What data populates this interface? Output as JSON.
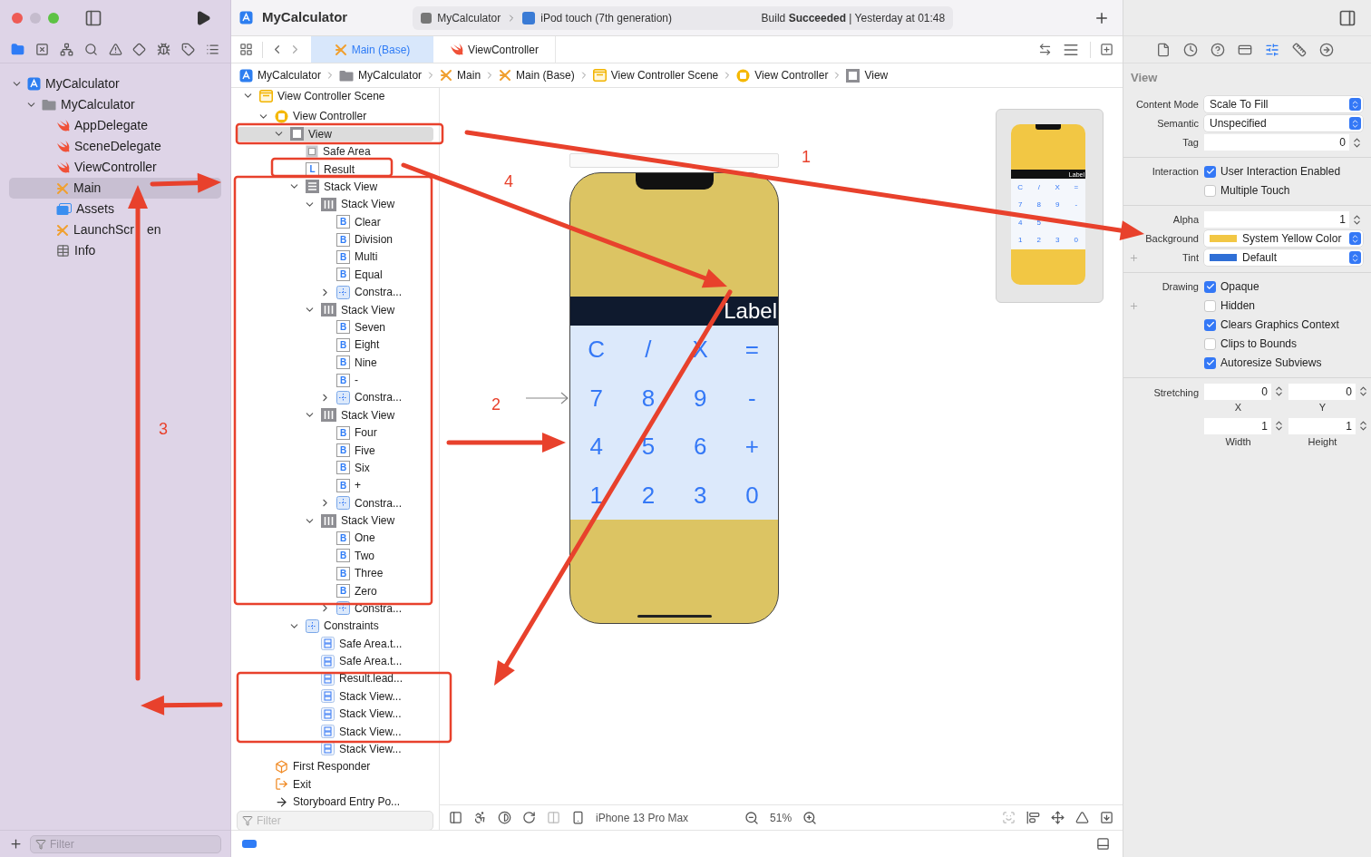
{
  "toolbar": {
    "project": "MyCalculator",
    "scheme": "MyCalculator",
    "device": "iPod touch (7th generation)",
    "status": "Build **Succeeded** | Yesterday at 01:48"
  },
  "navigator": {
    "tabs": [
      {
        "kind": "project-files",
        "selected": true
      },
      {
        "kind": "source-control",
        "selected": false
      },
      {
        "kind": "symbols",
        "selected": false
      },
      {
        "kind": "search",
        "selected": false
      },
      {
        "kind": "issues",
        "selected": false
      },
      {
        "kind": "tests",
        "selected": false
      },
      {
        "kind": "debug",
        "selected": false
      },
      {
        "kind": "breakpoints",
        "selected": false
      },
      {
        "kind": "reports",
        "selected": false
      }
    ],
    "tree": [
      {
        "label": "MyCalculator",
        "kind": "project",
        "expanded": true,
        "selected": false,
        "children": [
          {
            "label": "MyCalculator",
            "kind": "folder",
            "expanded": true,
            "selected": false,
            "children": [
              {
                "label": "AppDelegate",
                "kind": "swift",
                "selected": false
              },
              {
                "label": "SceneDelegate",
                "kind": "swift",
                "selected": false
              },
              {
                "label": "ViewController",
                "kind": "swift",
                "selected": false
              },
              {
                "label": "Main",
                "kind": "storyboard",
                "selected": true
              },
              {
                "label": "Assets",
                "kind": "assets",
                "selected": false
              },
              {
                "label": "LaunchScr",
                "label_tail": "en",
                "kind": "storyboard",
                "selected": false
              },
              {
                "label": "Info",
                "kind": "plist",
                "selected": false
              }
            ]
          }
        ]
      }
    ],
    "filter": {
      "placeholder": "Filter"
    }
  },
  "tabs": [
    {
      "label": "Main (Base)",
      "kind": "storyboard",
      "selected": true
    },
    {
      "label": "ViewController",
      "kind": "swift",
      "selected": false
    }
  ],
  "breadcrumb": [
    {
      "label": "MyCalculator",
      "kind": "project"
    },
    {
      "label": "MyCalculator",
      "kind": "folder"
    },
    {
      "label": "Main",
      "kind": "storyboard"
    },
    {
      "label": "Main (Base)",
      "kind": "storyboard"
    },
    {
      "label": "View Controller Scene",
      "kind": "scene"
    },
    {
      "label": "View Controller",
      "kind": "controller"
    },
    {
      "label": "View",
      "kind": "view"
    }
  ],
  "outline": {
    "tree": [
      {
        "label": "View Controller Scene",
        "kind": "scene",
        "expanded": true,
        "selected": false,
        "children": [
          {
            "label": "View Controller",
            "kind": "controller",
            "expanded": true,
            "selected": false,
            "children": [
              {
                "label": "View",
                "kind": "view",
                "expanded": true,
                "selected": true,
                "children": [
                  {
                    "label": "Safe Area",
                    "kind": "safe-area",
                    "selected": false
                  },
                  {
                    "label": "Result",
                    "kind": "badge",
                    "badge": "L",
                    "selected": false
                  },
                  {
                    "label": "Stack View",
                    "kind": "vstack",
                    "expanded": true,
                    "selected": false,
                    "children": [
                      {
                        "label": "Stack View",
                        "kind": "hstack",
                        "expanded": true,
                        "selected": false,
                        "children": [
                          {
                            "label": "Clear",
                            "kind": "badge",
                            "badge": "B",
                            "selected": false
                          },
                          {
                            "label": "Division",
                            "kind": "badge",
                            "badge": "B",
                            "selected": false
                          },
                          {
                            "label": "Multi",
                            "kind": "badge",
                            "badge": "B",
                            "selected": false
                          },
                          {
                            "label": "Equal",
                            "kind": "badge",
                            "badge": "B",
                            "selected": false
                          },
                          {
                            "label": "Constra...",
                            "kind": "constraints",
                            "expanded": false,
                            "selected": false
                          }
                        ]
                      },
                      {
                        "label": "Stack View",
                        "kind": "hstack",
                        "expanded": true,
                        "selected": false,
                        "children": [
                          {
                            "label": "Seven",
                            "kind": "badge",
                            "badge": "B",
                            "selected": false
                          },
                          {
                            "label": "Eight",
                            "kind": "badge",
                            "badge": "B",
                            "selected": false
                          },
                          {
                            "label": "Nine",
                            "kind": "badge",
                            "badge": "B",
                            "selected": false
                          },
                          {
                            "label": "-",
                            "kind": "badge",
                            "badge": "B",
                            "selected": false
                          },
                          {
                            "label": "Constra...",
                            "kind": "constraints",
                            "expanded": false,
                            "selected": false
                          }
                        ]
                      },
                      {
                        "label": "Stack View",
                        "kind": "hstack",
                        "expanded": true,
                        "selected": false,
                        "children": [
                          {
                            "label": "Four",
                            "kind": "badge",
                            "badge": "B",
                            "selected": false
                          },
                          {
                            "label": "Five",
                            "kind": "badge",
                            "badge": "B",
                            "selected": false
                          },
                          {
                            "label": "Six",
                            "kind": "badge",
                            "badge": "B",
                            "selected": false
                          },
                          {
                            "label": "+",
                            "kind": "badge",
                            "badge": "B",
                            "selected": false
                          },
                          {
                            "label": "Constra...",
                            "kind": "constraints",
                            "expanded": false,
                            "selected": false
                          }
                        ]
                      },
                      {
                        "label": "Stack View",
                        "kind": "hstack",
                        "expanded": true,
                        "selected": false,
                        "children": [
                          {
                            "label": "One",
                            "kind": "badge",
                            "badge": "B",
                            "selected": false
                          },
                          {
                            "label": "Two",
                            "kind": "badge",
                            "badge": "B",
                            "selected": false
                          },
                          {
                            "label": "Three",
                            "kind": "badge",
                            "badge": "B",
                            "selected": false
                          },
                          {
                            "label": "Zero",
                            "kind": "badge",
                            "badge": "B",
                            "selected": false
                          },
                          {
                            "label": "Constra...",
                            "kind": "constraints",
                            "expanded": false,
                            "selected": false
                          }
                        ]
                      }
                    ]
                  },
                  {
                    "label": "Constraints",
                    "kind": "constraints",
                    "expanded": true,
                    "selected": false,
                    "children": [
                      {
                        "label": "Safe Area.t...",
                        "kind": "constraint",
                        "selected": false
                      },
                      {
                        "label": "Safe Area.t...",
                        "kind": "constraint",
                        "selected": false
                      },
                      {
                        "label": "Result.lead...",
                        "kind": "constraint",
                        "selected": false
                      },
                      {
                        "label": "Stack View...",
                        "kind": "constraint",
                        "selected": false
                      },
                      {
                        "label": "Stack View...",
                        "kind": "constraint",
                        "selected": false
                      },
                      {
                        "label": "Stack View...",
                        "kind": "constraint",
                        "selected": false
                      },
                      {
                        "label": "Stack View...",
                        "kind": "constraint",
                        "selected": false
                      }
                    ]
                  }
                ]
              }
            ]
          },
          {
            "label": "First Responder",
            "kind": "responder",
            "selected": false
          },
          {
            "label": "Exit",
            "kind": "exit",
            "selected": false
          },
          {
            "label": "Storyboard Entry Po...",
            "kind": "entry",
            "selected": false
          }
        ]
      }
    ],
    "filter": {
      "placeholder": "Filter"
    }
  },
  "canvas": {
    "label": "Label",
    "keys": [
      "C",
      "/",
      "X",
      "=",
      "7",
      "8",
      "9",
      "-",
      "4",
      "5",
      "6",
      "+",
      "1",
      "2",
      "3",
      "0"
    ],
    "minimap": {
      "label": "Label",
      "rows": [
        [
          "C",
          "/",
          "X",
          "="
        ],
        [
          "7",
          "8",
          "9",
          "-"
        ],
        [
          "4",
          "5"
        ],
        [
          "1",
          "2",
          "3",
          "0"
        ]
      ]
    },
    "device": "iPhone 13 Pro Max",
    "zoom": "51%"
  },
  "inspector": {
    "tabs": [
      {
        "kind": "file",
        "selected": false
      },
      {
        "kind": "history",
        "selected": false
      },
      {
        "kind": "help",
        "selected": false
      },
      {
        "kind": "identity",
        "selected": false
      },
      {
        "kind": "attributes",
        "selected": true
      },
      {
        "kind": "size",
        "selected": false
      },
      {
        "kind": "connections",
        "selected": false
      }
    ],
    "title": "View",
    "sections": [
      {
        "rows": [
          {
            "kind": "select",
            "label": "Content Mode",
            "value": "Scale To Fill"
          },
          {
            "kind": "select",
            "label": "Semantic",
            "value": "Unspecified"
          },
          {
            "kind": "number",
            "label": "Tag",
            "value": "0"
          }
        ]
      },
      {
        "rows": [
          {
            "kind": "checkbox",
            "label": "Interaction",
            "text": "User Interaction Enabled",
            "checked": true
          },
          {
            "kind": "checkbox",
            "text": "Multiple Touch",
            "checked": false
          }
        ]
      },
      {
        "rows": [
          {
            "kind": "number",
            "label": "Alpha",
            "value": "1"
          },
          {
            "kind": "color",
            "label": "Background",
            "value": "System Yellow Color",
            "color": "#f2c744"
          },
          {
            "kind": "color",
            "label": "Tint",
            "value": "Default",
            "color": "#2f6fd6",
            "plus": true
          }
        ]
      },
      {
        "rows": [
          {
            "kind": "checkbox",
            "label": "Drawing",
            "text": "Opaque",
            "checked": true
          },
          {
            "kind": "checkbox",
            "text": "Hidden",
            "checked": false,
            "plus": true
          },
          {
            "kind": "checkbox",
            "text": "Clears Graphics Context",
            "checked": true
          },
          {
            "kind": "checkbox",
            "text": "Clips to Bounds",
            "checked": false
          },
          {
            "kind": "checkbox",
            "text": "Autoresize Subviews",
            "checked": true
          }
        ]
      },
      {
        "rows": [
          {
            "kind": "pair",
            "label": "Stretching",
            "fields": [
              {
                "value": "0",
                "caption": "X"
              },
              {
                "value": "0",
                "caption": "Y"
              }
            ]
          },
          {
            "kind": "pair",
            "fields": [
              {
                "value": "1",
                "caption": "Width"
              },
              {
                "value": "1",
                "caption": "Height"
              }
            ]
          }
        ]
      }
    ]
  },
  "annotations": [
    {
      "text": "1"
    },
    {
      "text": "4"
    },
    {
      "text": "2"
    },
    {
      "text": "3"
    }
  ]
}
